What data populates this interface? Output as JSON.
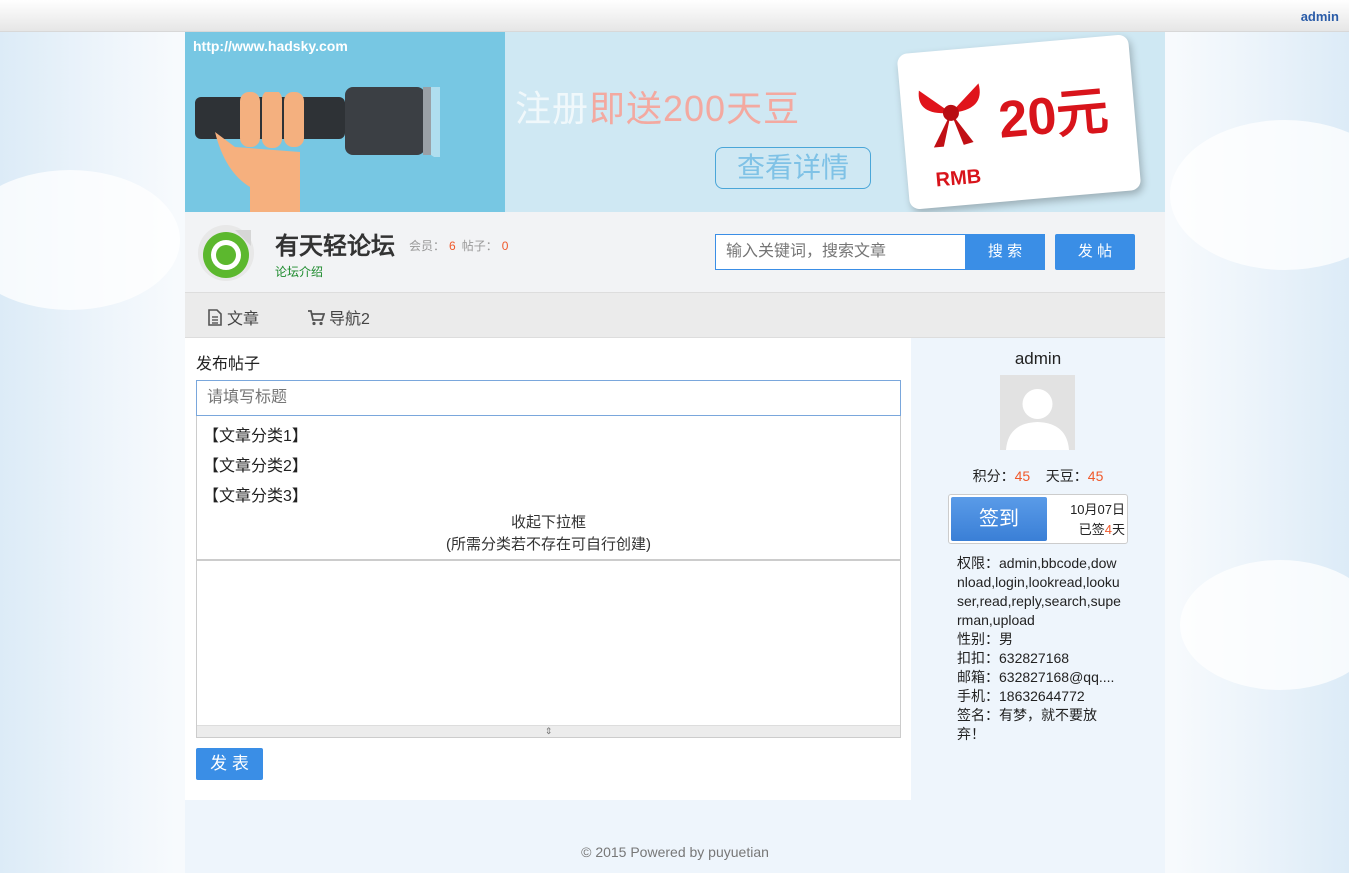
{
  "topbar": {
    "username": "admin"
  },
  "banner": {
    "url": "http://www.hadsky.com",
    "promo_faint": "注册",
    "promo_main": "即送200天豆",
    "detail_button": "查看详情",
    "card_amount": "20元",
    "card_currency": "RMB"
  },
  "header": {
    "site_title": "有天轻论坛",
    "members_label": "会员：",
    "members_count": "6",
    "posts_label": "帖子：",
    "posts_count": "0",
    "intro_link": "论坛介绍",
    "search_placeholder": "输入关键词，搜索文章",
    "search_button": "搜 索",
    "post_button": "发 帖"
  },
  "nav": {
    "items": [
      {
        "label": "文章",
        "icon": "document-icon"
      },
      {
        "label": "导航2",
        "icon": "cart-icon"
      }
    ]
  },
  "compose": {
    "heading": "发布帖子",
    "title_placeholder": "请填写标题",
    "categories": [
      "【文章分类1】",
      "【文章分类2】",
      "【文章分类3】"
    ],
    "collapse_label": "收起下拉框",
    "collapse_hint": "(所需分类若不存在可自行创建)",
    "submit_button": "发 表"
  },
  "sidebar": {
    "username": "admin",
    "points_label": "积分：",
    "points_value": "45",
    "beans_label": "天豆：",
    "beans_value": "45",
    "sign_button": "签到",
    "sign_date": "10月07日",
    "sign_prefix": "已签",
    "sign_days": "4",
    "sign_suffix": "天",
    "permissions": "权限：admin,bbcode,download,login,lookread,lookuser,read,reply,search,superman,upload",
    "gender": "性别：男",
    "qq": "扣扣：632827168",
    "email": "邮箱：632827168@qq....",
    "phone": "手机：18632644772",
    "signature": "签名：有梦，就不要放弃！"
  },
  "footer": {
    "text": "© 2015 Powered by puyuetian"
  },
  "colors": {
    "accent": "#3a8ee6",
    "highlight": "#f0592b",
    "intro_green": "#1c8a2c"
  }
}
